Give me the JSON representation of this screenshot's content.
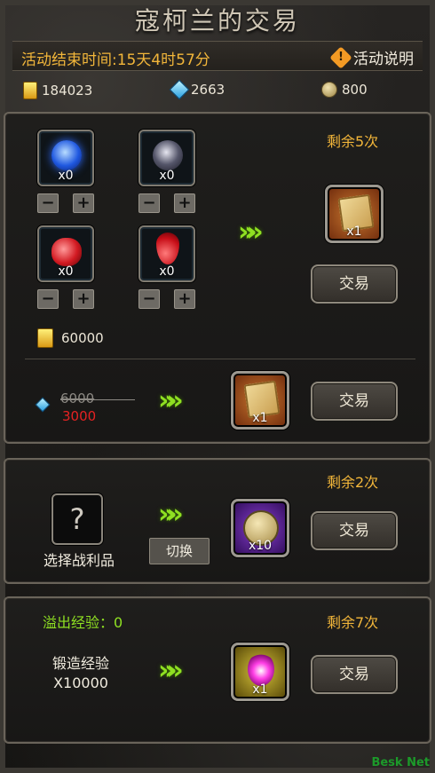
{
  "title": "寇柯兰的交易",
  "header": {
    "end_time": "活动结束时间:15天4时57分",
    "help_label": "活动说明"
  },
  "currencies": {
    "gold": "184023",
    "diamond": "2663",
    "coin": "800"
  },
  "panel1": {
    "remaining": "剩余5次",
    "materials": [
      {
        "icon": "blue-orb-icon",
        "count": "x0"
      },
      {
        "icon": "dark-orb-icon",
        "count": "x0"
      },
      {
        "icon": "red-orb-icon",
        "count": "x0"
      },
      {
        "icon": "red-drop-icon",
        "count": "x0"
      }
    ],
    "gold_cost": "60000",
    "reward_count": "x1",
    "trade_label": "交易",
    "alt_old_price": "6000",
    "alt_new_price": "3000",
    "alt_reward_count": "x1",
    "alt_trade_label": "交易"
  },
  "panel2": {
    "remaining": "剩余2次",
    "select_label": "选择战利品",
    "question_mark": "?",
    "switch_label": "切换",
    "reward_count": "x10",
    "trade_label": "交易"
  },
  "panel3": {
    "overflow": "溢出经验：0",
    "remaining": "剩余7次",
    "exp_label": "锻造经验",
    "exp_amount": "X10000",
    "reward_count": "x1",
    "trade_label": "交易"
  },
  "arrows": "»»",
  "watermark": "Besk Net",
  "colors": {
    "accent_orange": "#f2b63a",
    "arrow_green": "#8fe022",
    "price_red": "#e52222"
  }
}
